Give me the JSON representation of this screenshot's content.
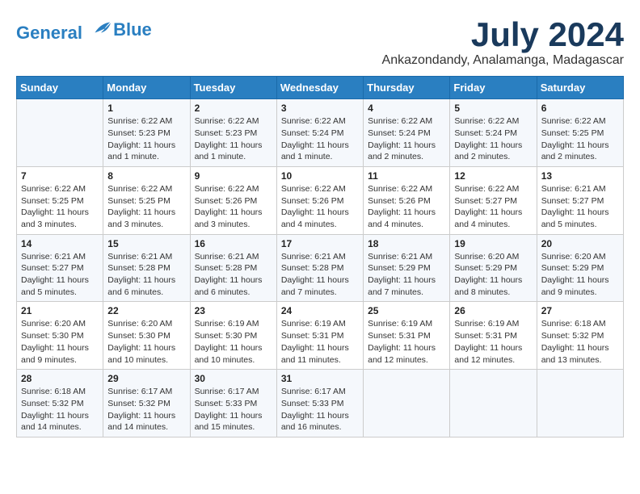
{
  "logo": {
    "line1": "General",
    "line2": "Blue"
  },
  "title": "July 2024",
  "location": "Ankazondandy, Analamanga, Madagascar",
  "weekdays": [
    "Sunday",
    "Monday",
    "Tuesday",
    "Wednesday",
    "Thursday",
    "Friday",
    "Saturday"
  ],
  "weeks": [
    [
      null,
      {
        "day": 1,
        "sunrise": "6:22 AM",
        "sunset": "5:23 PM",
        "daylight": "11 hours and 1 minute."
      },
      {
        "day": 2,
        "sunrise": "6:22 AM",
        "sunset": "5:23 PM",
        "daylight": "11 hours and 1 minute."
      },
      {
        "day": 3,
        "sunrise": "6:22 AM",
        "sunset": "5:24 PM",
        "daylight": "11 hours and 1 minute."
      },
      {
        "day": 4,
        "sunrise": "6:22 AM",
        "sunset": "5:24 PM",
        "daylight": "11 hours and 2 minutes."
      },
      {
        "day": 5,
        "sunrise": "6:22 AM",
        "sunset": "5:24 PM",
        "daylight": "11 hours and 2 minutes."
      },
      {
        "day": 6,
        "sunrise": "6:22 AM",
        "sunset": "5:25 PM",
        "daylight": "11 hours and 2 minutes."
      }
    ],
    [
      {
        "day": 7,
        "sunrise": "6:22 AM",
        "sunset": "5:25 PM",
        "daylight": "11 hours and 3 minutes."
      },
      {
        "day": 8,
        "sunrise": "6:22 AM",
        "sunset": "5:25 PM",
        "daylight": "11 hours and 3 minutes."
      },
      {
        "day": 9,
        "sunrise": "6:22 AM",
        "sunset": "5:26 PM",
        "daylight": "11 hours and 3 minutes."
      },
      {
        "day": 10,
        "sunrise": "6:22 AM",
        "sunset": "5:26 PM",
        "daylight": "11 hours and 4 minutes."
      },
      {
        "day": 11,
        "sunrise": "6:22 AM",
        "sunset": "5:26 PM",
        "daylight": "11 hours and 4 minutes."
      },
      {
        "day": 12,
        "sunrise": "6:22 AM",
        "sunset": "5:27 PM",
        "daylight": "11 hours and 4 minutes."
      },
      {
        "day": 13,
        "sunrise": "6:21 AM",
        "sunset": "5:27 PM",
        "daylight": "11 hours and 5 minutes."
      }
    ],
    [
      {
        "day": 14,
        "sunrise": "6:21 AM",
        "sunset": "5:27 PM",
        "daylight": "11 hours and 5 minutes."
      },
      {
        "day": 15,
        "sunrise": "6:21 AM",
        "sunset": "5:28 PM",
        "daylight": "11 hours and 6 minutes."
      },
      {
        "day": 16,
        "sunrise": "6:21 AM",
        "sunset": "5:28 PM",
        "daylight": "11 hours and 6 minutes."
      },
      {
        "day": 17,
        "sunrise": "6:21 AM",
        "sunset": "5:28 PM",
        "daylight": "11 hours and 7 minutes."
      },
      {
        "day": 18,
        "sunrise": "6:21 AM",
        "sunset": "5:29 PM",
        "daylight": "11 hours and 7 minutes."
      },
      {
        "day": 19,
        "sunrise": "6:20 AM",
        "sunset": "5:29 PM",
        "daylight": "11 hours and 8 minutes."
      },
      {
        "day": 20,
        "sunrise": "6:20 AM",
        "sunset": "5:29 PM",
        "daylight": "11 hours and 9 minutes."
      }
    ],
    [
      {
        "day": 21,
        "sunrise": "6:20 AM",
        "sunset": "5:30 PM",
        "daylight": "11 hours and 9 minutes."
      },
      {
        "day": 22,
        "sunrise": "6:20 AM",
        "sunset": "5:30 PM",
        "daylight": "11 hours and 10 minutes."
      },
      {
        "day": 23,
        "sunrise": "6:19 AM",
        "sunset": "5:30 PM",
        "daylight": "11 hours and 10 minutes."
      },
      {
        "day": 24,
        "sunrise": "6:19 AM",
        "sunset": "5:31 PM",
        "daylight": "11 hours and 11 minutes."
      },
      {
        "day": 25,
        "sunrise": "6:19 AM",
        "sunset": "5:31 PM",
        "daylight": "11 hours and 12 minutes."
      },
      {
        "day": 26,
        "sunrise": "6:19 AM",
        "sunset": "5:31 PM",
        "daylight": "11 hours and 12 minutes."
      },
      {
        "day": 27,
        "sunrise": "6:18 AM",
        "sunset": "5:32 PM",
        "daylight": "11 hours and 13 minutes."
      }
    ],
    [
      {
        "day": 28,
        "sunrise": "6:18 AM",
        "sunset": "5:32 PM",
        "daylight": "11 hours and 14 minutes."
      },
      {
        "day": 29,
        "sunrise": "6:17 AM",
        "sunset": "5:32 PM",
        "daylight": "11 hours and 14 minutes."
      },
      {
        "day": 30,
        "sunrise": "6:17 AM",
        "sunset": "5:33 PM",
        "daylight": "11 hours and 15 minutes."
      },
      {
        "day": 31,
        "sunrise": "6:17 AM",
        "sunset": "5:33 PM",
        "daylight": "11 hours and 16 minutes."
      },
      null,
      null,
      null
    ]
  ]
}
